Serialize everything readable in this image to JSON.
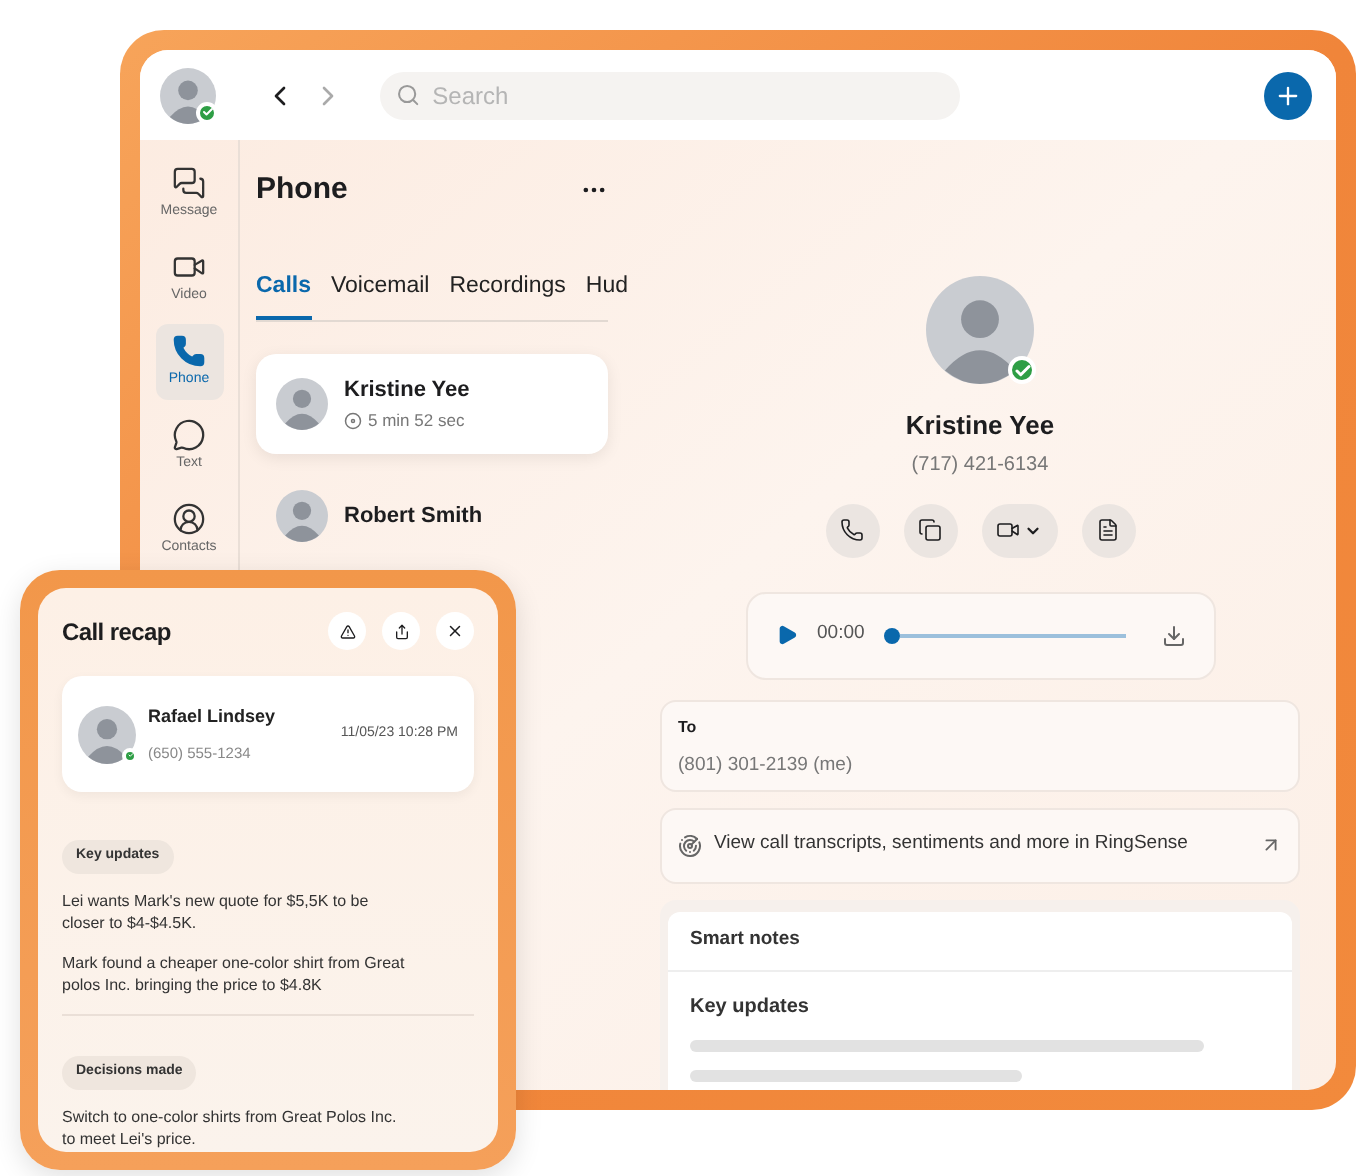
{
  "topbar": {
    "search": {
      "placeholder": "Search"
    }
  },
  "sidebar": {
    "items": [
      {
        "label": "Message",
        "selected": false
      },
      {
        "label": "Video",
        "selected": false
      },
      {
        "label": "Phone",
        "selected": true
      },
      {
        "label": "Text",
        "selected": false
      },
      {
        "label": "Contacts",
        "selected": false
      }
    ]
  },
  "phone": {
    "title": "Phone",
    "tabs": [
      {
        "label": "Calls",
        "selected": true
      },
      {
        "label": "Voicemail",
        "selected": false
      },
      {
        "label": "Recordings",
        "selected": false
      },
      {
        "label": "Hud",
        "selected": false
      }
    ],
    "calls": [
      {
        "name": "Kristine Yee",
        "duration": "5 min 52 sec",
        "selected": true
      },
      {
        "name": "Robert Smith",
        "selected": false
      }
    ]
  },
  "detail": {
    "name": "Kristine Yee",
    "phone": "(717) 421-6134",
    "player": {
      "time": "00:00",
      "level": 0
    },
    "to": {
      "label": "To",
      "value": "(801) 301-2139 (me)"
    },
    "ringsense": "View call transcripts, sentiments and more in RingSense",
    "smart_notes": {
      "title": "Smart notes",
      "section": "Key updates"
    }
  },
  "recap": {
    "title": "Call recap",
    "contact": {
      "name": "Rafael Lindsey",
      "phone": "(650) 555-1234",
      "time": "11/05/23 10:28 PM"
    },
    "sections": [
      {
        "heading": "Key updates",
        "items": [
          "Lei wants Mark's new quote for $5,5K to be closer to $4-$4.5K.",
          "Mark found a cheaper one-color shirt from Great polos Inc. bringing the price to $4.8K"
        ]
      },
      {
        "heading": "Decisions made",
        "items": [
          "Switch to one-color shirts from Great Polos Inc. to meet Lei's price."
        ]
      }
    ]
  }
}
